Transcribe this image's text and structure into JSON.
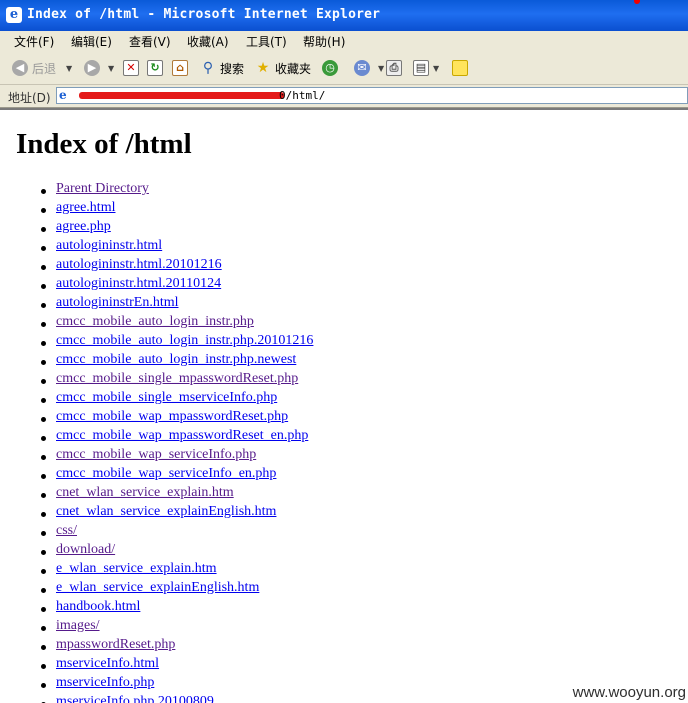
{
  "window": {
    "title": "Index of /html - Microsoft Internet Explorer",
    "ie_icon_glyph": "e"
  },
  "menu": [
    "文件(F)",
    "编辑(E)",
    "查看(V)",
    "收藏(A)",
    "工具(T)",
    "帮助(H)"
  ],
  "toolbar": {
    "back_label": "后退",
    "search_label": "搜索",
    "favorites_label": "收藏夹"
  },
  "address": {
    "label": "地址(D)",
    "url_visible_suffix": "0/html/"
  },
  "page": {
    "heading": "Index of /html",
    "link_color": "#0000ee",
    "visited_color": "#551a8b",
    "entries": [
      {
        "text": "Parent Directory",
        "visited": true
      },
      {
        "text": "agree.html",
        "visited": false
      },
      {
        "text": "agree.php",
        "visited": false
      },
      {
        "text": "autologininstr.html",
        "visited": false
      },
      {
        "text": "autologininstr.html.20101216",
        "visited": false
      },
      {
        "text": "autologininstr.html.20110124",
        "visited": false
      },
      {
        "text": "autologininstrEn.html",
        "visited": false
      },
      {
        "text": "cmcc_mobile_auto_login_instr.php",
        "visited": true
      },
      {
        "text": "cmcc_mobile_auto_login_instr.php.20101216",
        "visited": false
      },
      {
        "text": "cmcc_mobile_auto_login_instr.php.newest",
        "visited": false
      },
      {
        "text": "cmcc_mobile_single_mpasswordReset.php",
        "visited": true
      },
      {
        "text": "cmcc_mobile_single_mserviceInfo.php",
        "visited": false
      },
      {
        "text": "cmcc_mobile_wap_mpasswordReset.php",
        "visited": false
      },
      {
        "text": "cmcc_mobile_wap_mpasswordReset_en.php",
        "visited": false
      },
      {
        "text": "cmcc_mobile_wap_serviceInfo.php",
        "visited": true
      },
      {
        "text": "cmcc_mobile_wap_serviceInfo_en.php",
        "visited": false
      },
      {
        "text": "cnet_wlan_service_explain.htm",
        "visited": true
      },
      {
        "text": "cnet_wlan_service_explainEnglish.htm",
        "visited": false
      },
      {
        "text": "css/",
        "visited": true
      },
      {
        "text": "download/",
        "visited": true
      },
      {
        "text": "e_wlan_service_explain.htm",
        "visited": false
      },
      {
        "text": "e_wlan_service_explainEnglish.htm",
        "visited": false
      },
      {
        "text": "handbook.html",
        "visited": false
      },
      {
        "text": "images/",
        "visited": true
      },
      {
        "text": "mpasswordReset.php",
        "visited": true
      },
      {
        "text": "mserviceInfo.html",
        "visited": false
      },
      {
        "text": "mserviceInfo.php",
        "visited": false
      },
      {
        "text": "mserviceInfo.php.20100809",
        "visited": false
      }
    ]
  },
  "watermark": "www.wooyun.org"
}
